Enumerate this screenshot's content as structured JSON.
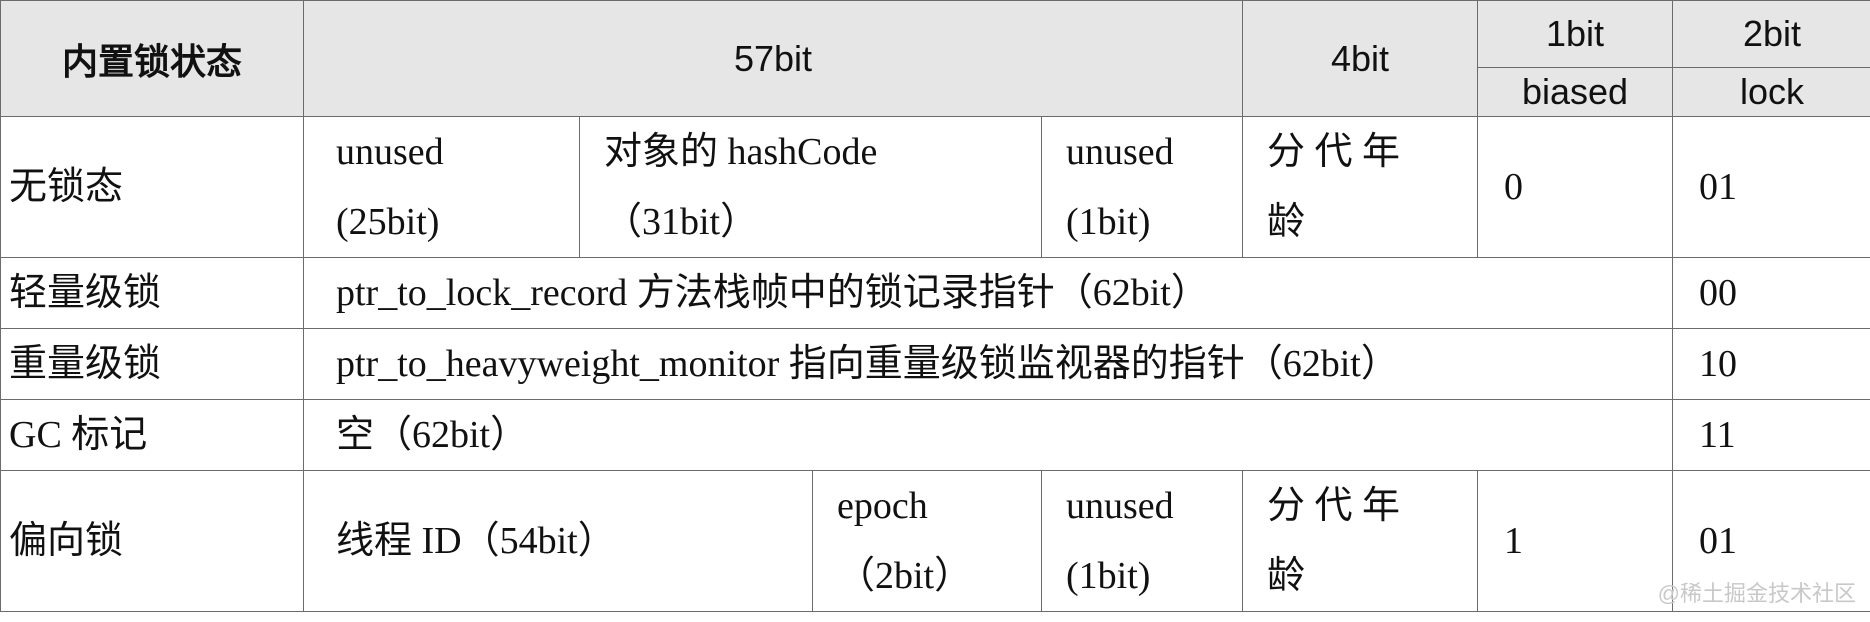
{
  "header": {
    "state": "内置锁状态",
    "bits57": "57bit",
    "bits4": "4bit",
    "bits1": "1bit",
    "bits2": "2bit",
    "biased": "biased",
    "lock": "lock"
  },
  "rows": {
    "nolock": {
      "state": "无锁态",
      "unused25_line1": "unused",
      "unused25_line2": "(25bit)",
      "hash_line1": "对象的 hashCode",
      "hash_line2": "（31bit）",
      "unused1_line1": "unused",
      "unused1_line2": "(1bit)",
      "age_line1": "分 代 年",
      "age_line2": "龄",
      "biased": "0",
      "lock": "01"
    },
    "light": {
      "state": "轻量级锁",
      "content": "ptr_to_lock_record 方法栈帧中的锁记录指针（62bit）",
      "lock": "00"
    },
    "heavy": {
      "state": "重量级锁",
      "content": "ptr_to_heavyweight_monitor 指向重量级锁监视器的指针（62bit）",
      "lock": "10"
    },
    "gc": {
      "state": "GC 标记",
      "content": "空（62bit）",
      "lock": "11"
    },
    "biased": {
      "state": "偏向锁",
      "thread": "线程 ID（54bit）",
      "epoch_line1": "epoch",
      "epoch_line2": "（2bit）",
      "unused1_line1": "unused",
      "unused1_line2": "(1bit)",
      "age_line1": "分 代 年",
      "age_line2": "龄",
      "biased": "1",
      "lock": "01"
    }
  },
  "watermark": "@稀土掘金技术社区"
}
